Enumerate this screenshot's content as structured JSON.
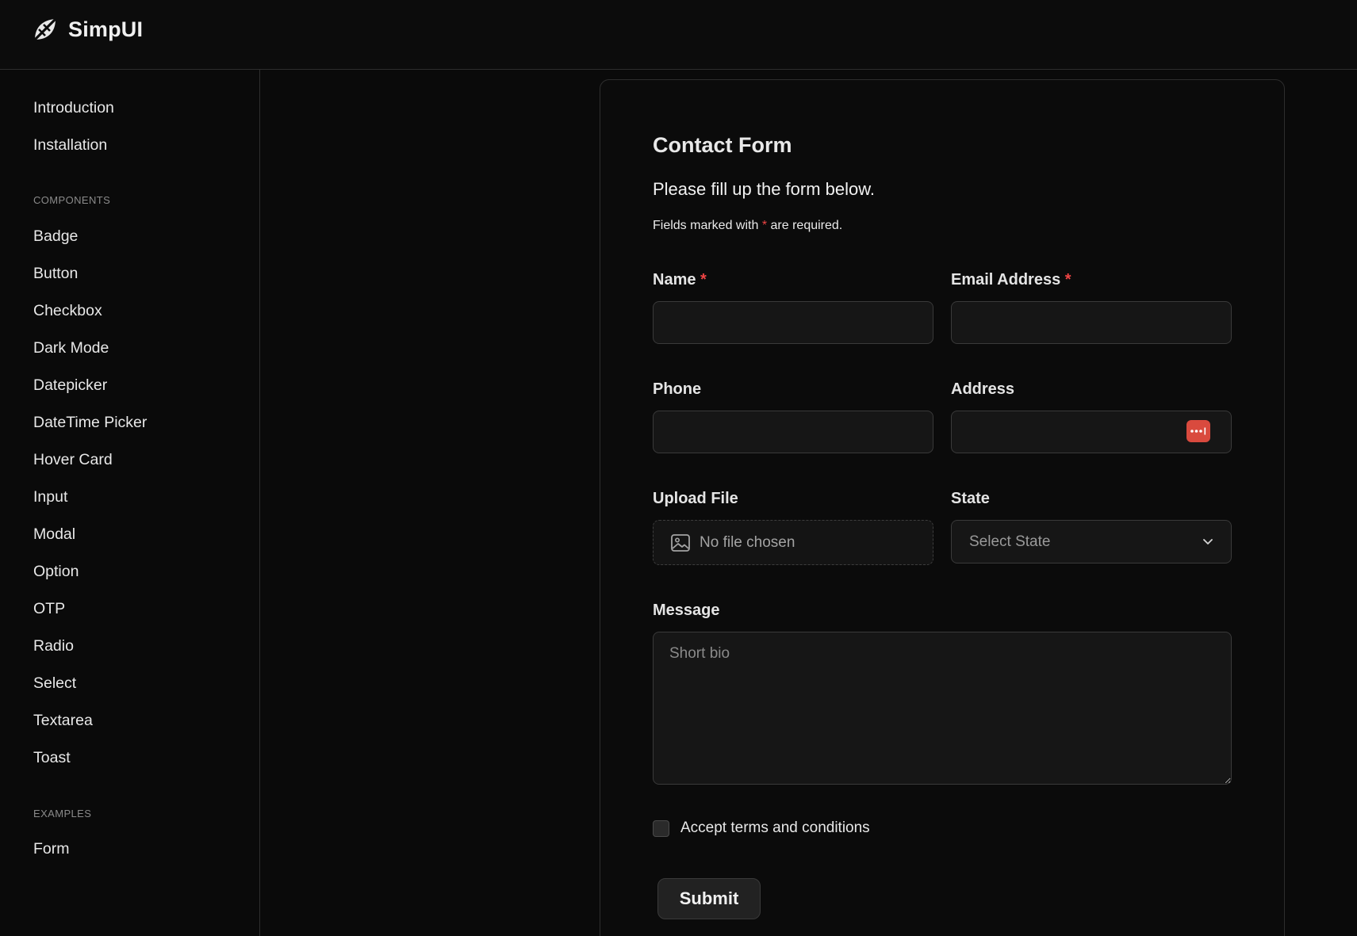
{
  "app": {
    "name": "SimpUI"
  },
  "sidebar": {
    "top_items": [
      {
        "label": "Introduction"
      },
      {
        "label": "Installation"
      }
    ],
    "components_heading": "COMPONENTS",
    "components": [
      {
        "label": "Badge"
      },
      {
        "label": "Button"
      },
      {
        "label": "Checkbox"
      },
      {
        "label": "Dark Mode"
      },
      {
        "label": "Datepicker"
      },
      {
        "label": "DateTime Picker"
      },
      {
        "label": "Hover Card"
      },
      {
        "label": "Input"
      },
      {
        "label": "Modal"
      },
      {
        "label": "Option"
      },
      {
        "label": "OTP"
      },
      {
        "label": "Radio"
      },
      {
        "label": "Select"
      },
      {
        "label": "Textarea"
      },
      {
        "label": "Toast"
      }
    ],
    "examples_heading": "EXAMPLES",
    "examples": [
      {
        "label": "Form"
      }
    ]
  },
  "form": {
    "title": "Contact Form",
    "subtitle": "Please fill up the form below.",
    "note_prefix": "Fields marked with",
    "required_marker": "*",
    "note_suffix": "are required.",
    "fields": {
      "name": {
        "label": "Name",
        "value": ""
      },
      "email": {
        "label": "Email Address",
        "value": ""
      },
      "phone": {
        "label": "Phone",
        "value": ""
      },
      "address": {
        "label": "Address",
        "value": ""
      },
      "upload": {
        "label": "Upload File",
        "text": "No file chosen"
      },
      "state": {
        "label": "State",
        "selected": "Select State"
      },
      "message": {
        "label": "Message",
        "placeholder": "Short bio",
        "value": ""
      }
    },
    "terms_label": "Accept terms and conditions",
    "terms_checked": false,
    "submit_label": "Submit"
  },
  "colors": {
    "background": "#0a0a0a",
    "required": "#ef4444",
    "password_manager_badge": "#d94a3e"
  },
  "icons": {
    "logo": "slashed-leaf-logo-icon",
    "upload": "image-icon",
    "select": "chevron-down-icon",
    "address_badge": "password-manager-icon"
  }
}
